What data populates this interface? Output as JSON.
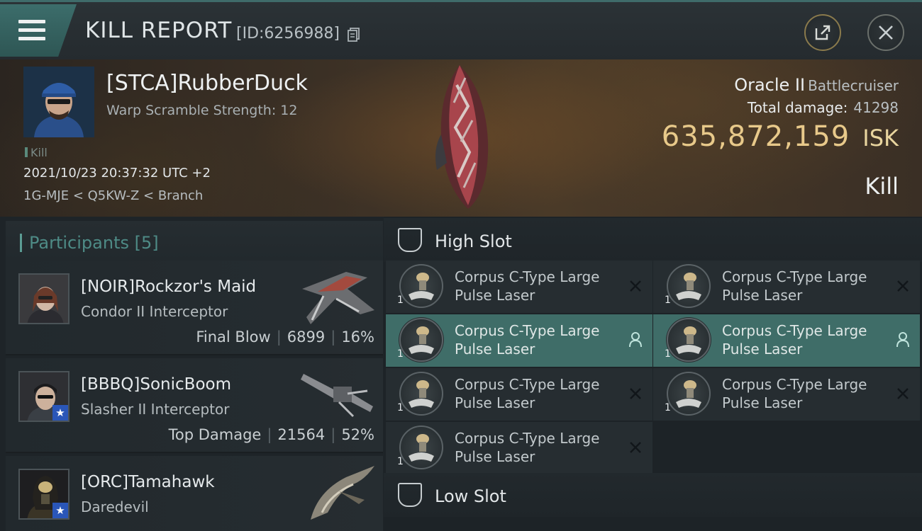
{
  "header": {
    "title": "KILL REPORT",
    "report_id": "[ID:6256988]",
    "icons": [
      "menu-icon",
      "copy-icon",
      "share-icon",
      "close-icon"
    ]
  },
  "victim": {
    "name": "[STCA]RubberDuck",
    "warp_scramble": "Warp Scramble Strength: 12",
    "tag": "Kill",
    "datetime": "2021/10/23 20:37:32 UTC +2",
    "location": "1G-MJE < Q5KW-Z < Branch",
    "ship_name": "Oracle II",
    "ship_class": "Battlecruiser",
    "total_damage_label": "Total damage:",
    "total_damage": "41298",
    "isk_value": "635,872,159",
    "isk_unit": "ISK",
    "result": "Kill"
  },
  "participants": {
    "title": "Participants",
    "count": "[5]",
    "rows": [
      {
        "name": "[NOIR]Rockzor's Maid",
        "ship": "Condor II Interceptor",
        "role": "Final Blow",
        "damage": "6899",
        "percent": "16%",
        "has_badge": false
      },
      {
        "name": "[BBBQ]SonicBoom",
        "ship": "Slasher II Interceptor",
        "role": "Top Damage",
        "damage": "21564",
        "percent": "52%",
        "has_badge": true
      },
      {
        "name": "[ORC]Tamahawk",
        "ship": "Daredevil",
        "role": "",
        "damage": "",
        "percent": "",
        "has_badge": true
      }
    ]
  },
  "fittings": {
    "high_slot_label": "High Slot",
    "low_slot_label": "Low Slot",
    "modules": [
      {
        "name_line1": "Corpus C-Type Large",
        "name_line2": "Pulse Laser",
        "qty": "1",
        "status": "destroyed"
      },
      {
        "name_line1": "Corpus C-Type Large",
        "name_line2": "Pulse Laser",
        "qty": "1",
        "status": "destroyed"
      },
      {
        "name_line1": "Corpus C-Type Large",
        "name_line2": "Pulse Laser",
        "qty": "1",
        "status": "dropped"
      },
      {
        "name_line1": "Corpus C-Type Large",
        "name_line2": "Pulse Laser",
        "qty": "1",
        "status": "dropped"
      },
      {
        "name_line1": "Corpus C-Type Large",
        "name_line2": "Pulse Laser",
        "qty": "1",
        "status": "destroyed"
      },
      {
        "name_line1": "Corpus C-Type Large",
        "name_line2": "Pulse Laser",
        "qty": "1",
        "status": "destroyed"
      },
      {
        "name_line1": "Corpus C-Type Large",
        "name_line2": "Pulse Laser",
        "qty": "1",
        "status": "destroyed"
      }
    ]
  },
  "colors": {
    "accent_teal": "#3f6d68",
    "isk_gold": "#e8c98a",
    "participants_title": "#4e8b86"
  }
}
